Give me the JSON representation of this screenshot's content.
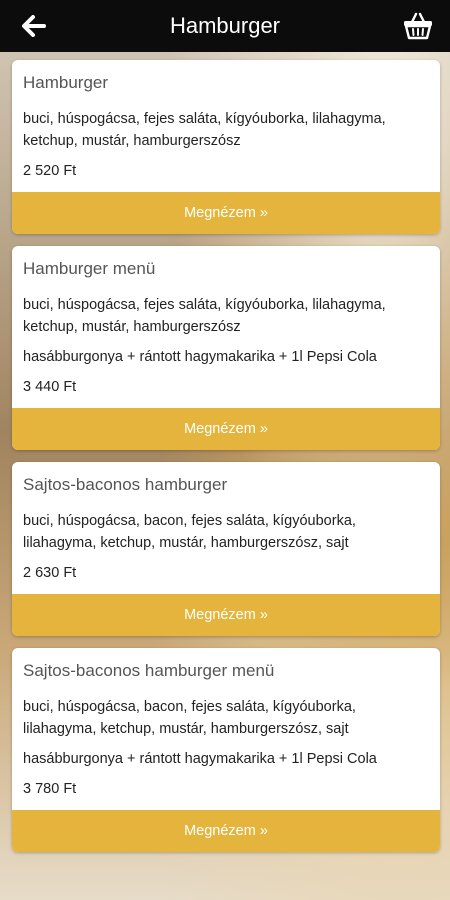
{
  "header": {
    "title": "Hamburger",
    "back_icon": "arrow-left-icon",
    "basket_icon": "basket-icon"
  },
  "colors": {
    "topbar": "#0c0c0c",
    "accent": "#e4b43c"
  },
  "items": [
    {
      "name": "Hamburger",
      "description": "buci, húspogácsa, fejes saláta, kígyóuborka, lilahagyma, ketchup, mustár, hamburgerszósz",
      "extra": "",
      "price": "2 520 Ft",
      "button": "Megnézem »"
    },
    {
      "name": "Hamburger menü",
      "description": "buci, húspogácsa, fejes saláta, kígyóuborka, lilahagyma, ketchup, mustár, hamburgerszósz",
      "extra": "hasábburgonya + rántott hagymakarika + 1l Pepsi Cola",
      "price": "3 440 Ft",
      "button": "Megnézem »"
    },
    {
      "name": "Sajtos-baconos hamburger",
      "description": "buci, húspogácsa, bacon, fejes saláta, kígyóuborka, lilahagyma, ketchup, mustár, hamburgerszósz, sajt",
      "extra": "",
      "price": "2 630 Ft",
      "button": "Megnézem »"
    },
    {
      "name": "Sajtos-baconos hamburger menü",
      "description": "buci, húspogácsa, bacon, fejes saláta, kígyóuborka, lilahagyma, ketchup, mustár, hamburgerszósz, sajt",
      "extra": "hasábburgonya + rántott hagymakarika + 1l Pepsi Cola",
      "price": "3 780 Ft",
      "button": "Megnézem »"
    }
  ]
}
